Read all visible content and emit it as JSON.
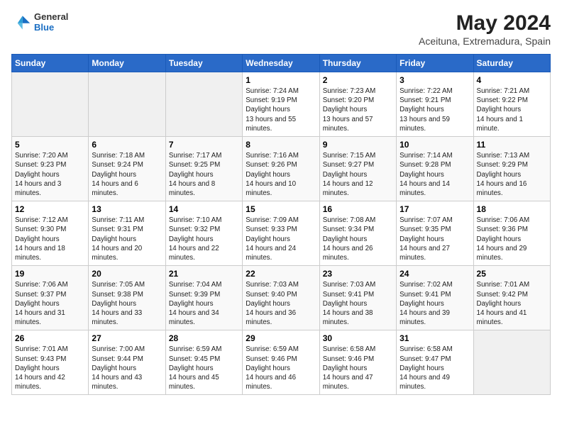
{
  "header": {
    "logo_general": "General",
    "logo_blue": "Blue",
    "title": "May 2024",
    "subtitle": "Aceituna, Extremadura, Spain"
  },
  "weekdays": [
    "Sunday",
    "Monday",
    "Tuesday",
    "Wednesday",
    "Thursday",
    "Friday",
    "Saturday"
  ],
  "weeks": [
    [
      {
        "day": "",
        "empty": true
      },
      {
        "day": "",
        "empty": true
      },
      {
        "day": "",
        "empty": true
      },
      {
        "day": "1",
        "sunrise": "7:24 AM",
        "sunset": "9:19 PM",
        "daylight": "13 hours and 55 minutes."
      },
      {
        "day": "2",
        "sunrise": "7:23 AM",
        "sunset": "9:20 PM",
        "daylight": "13 hours and 57 minutes."
      },
      {
        "day": "3",
        "sunrise": "7:22 AM",
        "sunset": "9:21 PM",
        "daylight": "13 hours and 59 minutes."
      },
      {
        "day": "4",
        "sunrise": "7:21 AM",
        "sunset": "9:22 PM",
        "daylight": "14 hours and 1 minute."
      }
    ],
    [
      {
        "day": "5",
        "sunrise": "7:20 AM",
        "sunset": "9:23 PM",
        "daylight": "14 hours and 3 minutes."
      },
      {
        "day": "6",
        "sunrise": "7:18 AM",
        "sunset": "9:24 PM",
        "daylight": "14 hours and 6 minutes."
      },
      {
        "day": "7",
        "sunrise": "7:17 AM",
        "sunset": "9:25 PM",
        "daylight": "14 hours and 8 minutes."
      },
      {
        "day": "8",
        "sunrise": "7:16 AM",
        "sunset": "9:26 PM",
        "daylight": "14 hours and 10 minutes."
      },
      {
        "day": "9",
        "sunrise": "7:15 AM",
        "sunset": "9:27 PM",
        "daylight": "14 hours and 12 minutes."
      },
      {
        "day": "10",
        "sunrise": "7:14 AM",
        "sunset": "9:28 PM",
        "daylight": "14 hours and 14 minutes."
      },
      {
        "day": "11",
        "sunrise": "7:13 AM",
        "sunset": "9:29 PM",
        "daylight": "14 hours and 16 minutes."
      }
    ],
    [
      {
        "day": "12",
        "sunrise": "7:12 AM",
        "sunset": "9:30 PM",
        "daylight": "14 hours and 18 minutes."
      },
      {
        "day": "13",
        "sunrise": "7:11 AM",
        "sunset": "9:31 PM",
        "daylight": "14 hours and 20 minutes."
      },
      {
        "day": "14",
        "sunrise": "7:10 AM",
        "sunset": "9:32 PM",
        "daylight": "14 hours and 22 minutes."
      },
      {
        "day": "15",
        "sunrise": "7:09 AM",
        "sunset": "9:33 PM",
        "daylight": "14 hours and 24 minutes."
      },
      {
        "day": "16",
        "sunrise": "7:08 AM",
        "sunset": "9:34 PM",
        "daylight": "14 hours and 26 minutes."
      },
      {
        "day": "17",
        "sunrise": "7:07 AM",
        "sunset": "9:35 PM",
        "daylight": "14 hours and 27 minutes."
      },
      {
        "day": "18",
        "sunrise": "7:06 AM",
        "sunset": "9:36 PM",
        "daylight": "14 hours and 29 minutes."
      }
    ],
    [
      {
        "day": "19",
        "sunrise": "7:06 AM",
        "sunset": "9:37 PM",
        "daylight": "14 hours and 31 minutes."
      },
      {
        "day": "20",
        "sunrise": "7:05 AM",
        "sunset": "9:38 PM",
        "daylight": "14 hours and 33 minutes."
      },
      {
        "day": "21",
        "sunrise": "7:04 AM",
        "sunset": "9:39 PM",
        "daylight": "14 hours and 34 minutes."
      },
      {
        "day": "22",
        "sunrise": "7:03 AM",
        "sunset": "9:40 PM",
        "daylight": "14 hours and 36 minutes."
      },
      {
        "day": "23",
        "sunrise": "7:03 AM",
        "sunset": "9:41 PM",
        "daylight": "14 hours and 38 minutes."
      },
      {
        "day": "24",
        "sunrise": "7:02 AM",
        "sunset": "9:41 PM",
        "daylight": "14 hours and 39 minutes."
      },
      {
        "day": "25",
        "sunrise": "7:01 AM",
        "sunset": "9:42 PM",
        "daylight": "14 hours and 41 minutes."
      }
    ],
    [
      {
        "day": "26",
        "sunrise": "7:01 AM",
        "sunset": "9:43 PM",
        "daylight": "14 hours and 42 minutes."
      },
      {
        "day": "27",
        "sunrise": "7:00 AM",
        "sunset": "9:44 PM",
        "daylight": "14 hours and 43 minutes."
      },
      {
        "day": "28",
        "sunrise": "6:59 AM",
        "sunset": "9:45 PM",
        "daylight": "14 hours and 45 minutes."
      },
      {
        "day": "29",
        "sunrise": "6:59 AM",
        "sunset": "9:46 PM",
        "daylight": "14 hours and 46 minutes."
      },
      {
        "day": "30",
        "sunrise": "6:58 AM",
        "sunset": "9:46 PM",
        "daylight": "14 hours and 47 minutes."
      },
      {
        "day": "31",
        "sunrise": "6:58 AM",
        "sunset": "9:47 PM",
        "daylight": "14 hours and 49 minutes."
      },
      {
        "day": "",
        "empty": true
      }
    ]
  ],
  "labels": {
    "sunrise": "Sunrise:",
    "sunset": "Sunset:",
    "daylight": "Daylight hours"
  }
}
